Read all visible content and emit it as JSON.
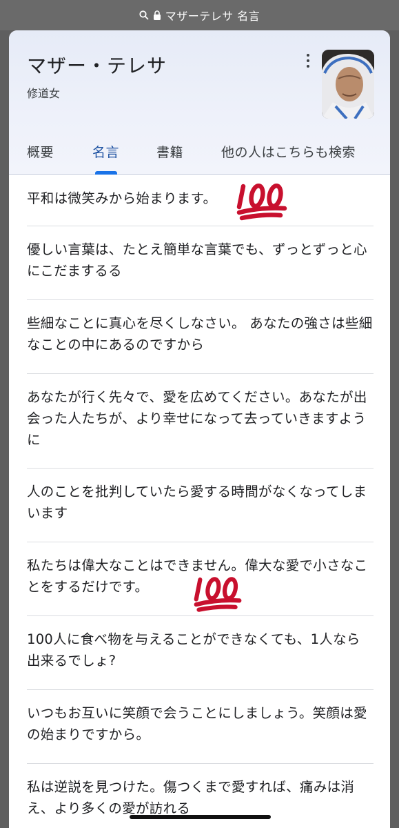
{
  "address_bar": {
    "text": "マザーテレサ 名言"
  },
  "knowledge_panel": {
    "title": "マザー・テレサ",
    "subtitle": "修道女",
    "tabs": [
      {
        "label": "概要",
        "active": false
      },
      {
        "label": "名言",
        "active": true
      },
      {
        "label": "書籍",
        "active": false
      },
      {
        "label": "他の人はこちらも検索",
        "active": false
      }
    ]
  },
  "quotes": [
    {
      "text": "平和は微笑みから始まります。",
      "emoji": "100"
    },
    {
      "text": "優しい言葉は、たとえ簡単な言葉でも、ずっとずっと心にこだまするる"
    },
    {
      "text": "些細なことに真心を尽くしなさい。 あなたの強さは些細なことの中にあるのですから"
    },
    {
      "text": "あなたが行く先々で、愛を広めてください。あなたが出会った人たちが、より幸せになって去っていきますように"
    },
    {
      "text": "人のことを批判していたら愛する時間がなくなってしまいます"
    },
    {
      "text": "私たちは偉大なことはできません。偉大な愛で小さなことをするだけです。",
      "emoji": "100"
    },
    {
      "text": "100人に食べ物を与えることができなくても、1人なら出来るでしょ?"
    },
    {
      "text": "いつもお互いに笑顔で会うことにしましょう。笑顔は愛の始まりですから。"
    },
    {
      "text": "私は逆説を見つけた。傷つくまで愛すれば、痛みは消え、より多くの愛が訪れる"
    }
  ],
  "colors": {
    "accent": "#1a73e8",
    "emoji_red": "#c8102e",
    "header_bg": "#e6ebf7"
  }
}
